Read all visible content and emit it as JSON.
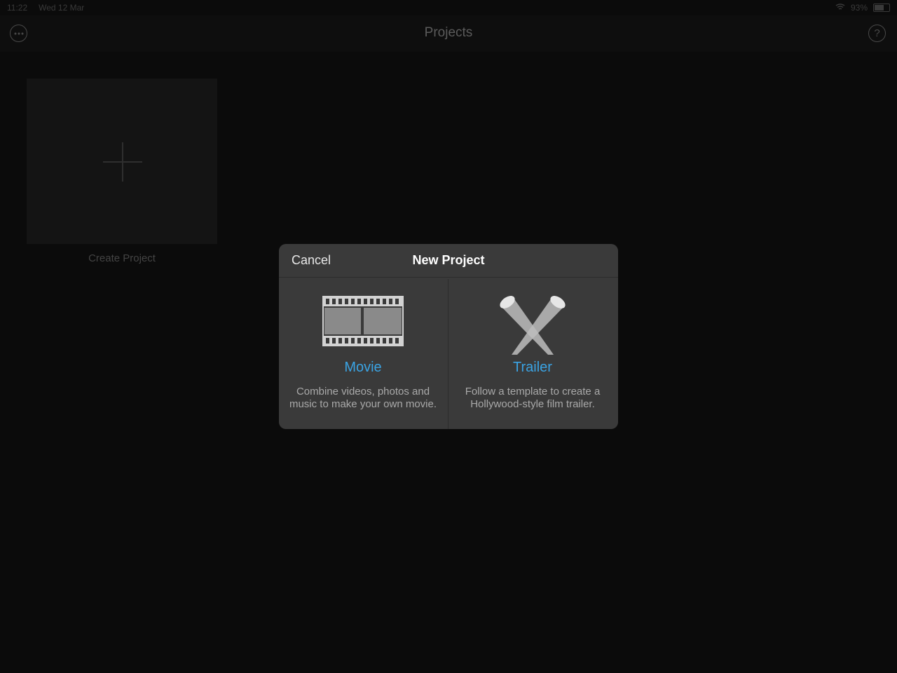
{
  "status_bar": {
    "time": "11:22",
    "date": "Wed 12 Mar",
    "battery": "93%"
  },
  "nav": {
    "title": "Projects",
    "more_icon": "more-icon",
    "help_icon": "help-icon",
    "help_glyph": "?"
  },
  "tile": {
    "label": "Create Project",
    "icon": "plus-icon"
  },
  "dialog": {
    "cancel_label": "Cancel",
    "title": "New Project",
    "options": [
      {
        "title": "Movie",
        "description_line1": "Combine videos, photos and",
        "description_line2": "music to make your own movie.",
        "icon": "film-strip-icon"
      },
      {
        "title": "Trailer",
        "description_line1": "Follow a template to create a",
        "description_line2": "Hollywood-style film trailer.",
        "icon": "spotlights-icon"
      }
    ]
  },
  "colors": {
    "background": "#0b0b0b",
    "dialog": "#3a3a3a",
    "accent": "#3aa3e3",
    "title_text": "#ffffff"
  }
}
